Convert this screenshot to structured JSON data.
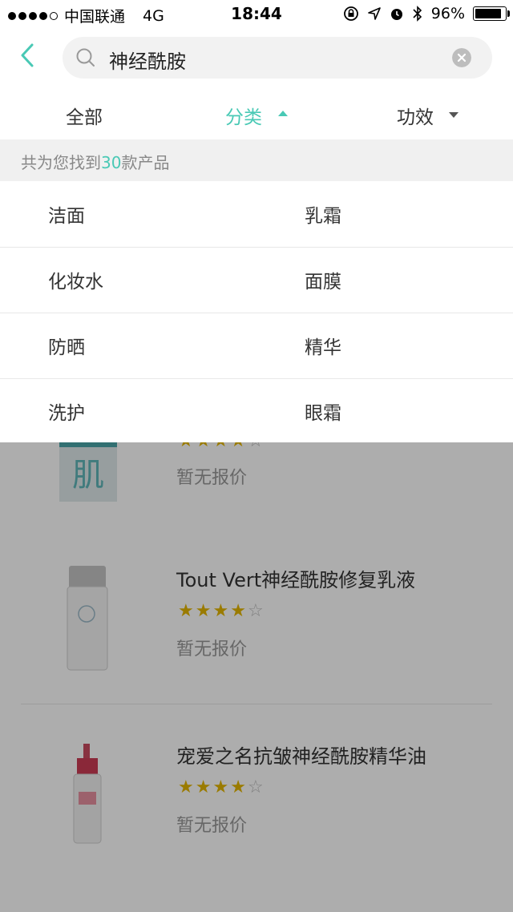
{
  "status_bar": {
    "carrier": "中国联通",
    "network": "4G",
    "time": "18:44",
    "battery": "96%",
    "battery_level": 0.96
  },
  "search": {
    "query": "神经酰胺"
  },
  "filters": {
    "all_label": "全部",
    "category_label": "分类",
    "effect_label": "功效"
  },
  "results": {
    "prefix": "共为您找到",
    "count": "30",
    "suffix": "款产品"
  },
  "categories": [
    {
      "left": "洁面",
      "right": "乳霜"
    },
    {
      "left": "化妆水",
      "right": "面膜"
    },
    {
      "left": "防晒",
      "right": "精华"
    },
    {
      "left": "洗护",
      "right": "眼霜"
    }
  ],
  "products": [
    {
      "name": "",
      "price": "暂无报价",
      "rating": 4
    },
    {
      "name": "Tout Vert神经酰胺修复乳液",
      "price": "暂无报价",
      "rating": 4
    },
    {
      "name": "宠爱之名抗皱神经酰胺精华油",
      "price": "暂无报价",
      "rating": 4
    }
  ],
  "colors": {
    "accent": "#49c9b5",
    "star": "#e4b500"
  }
}
